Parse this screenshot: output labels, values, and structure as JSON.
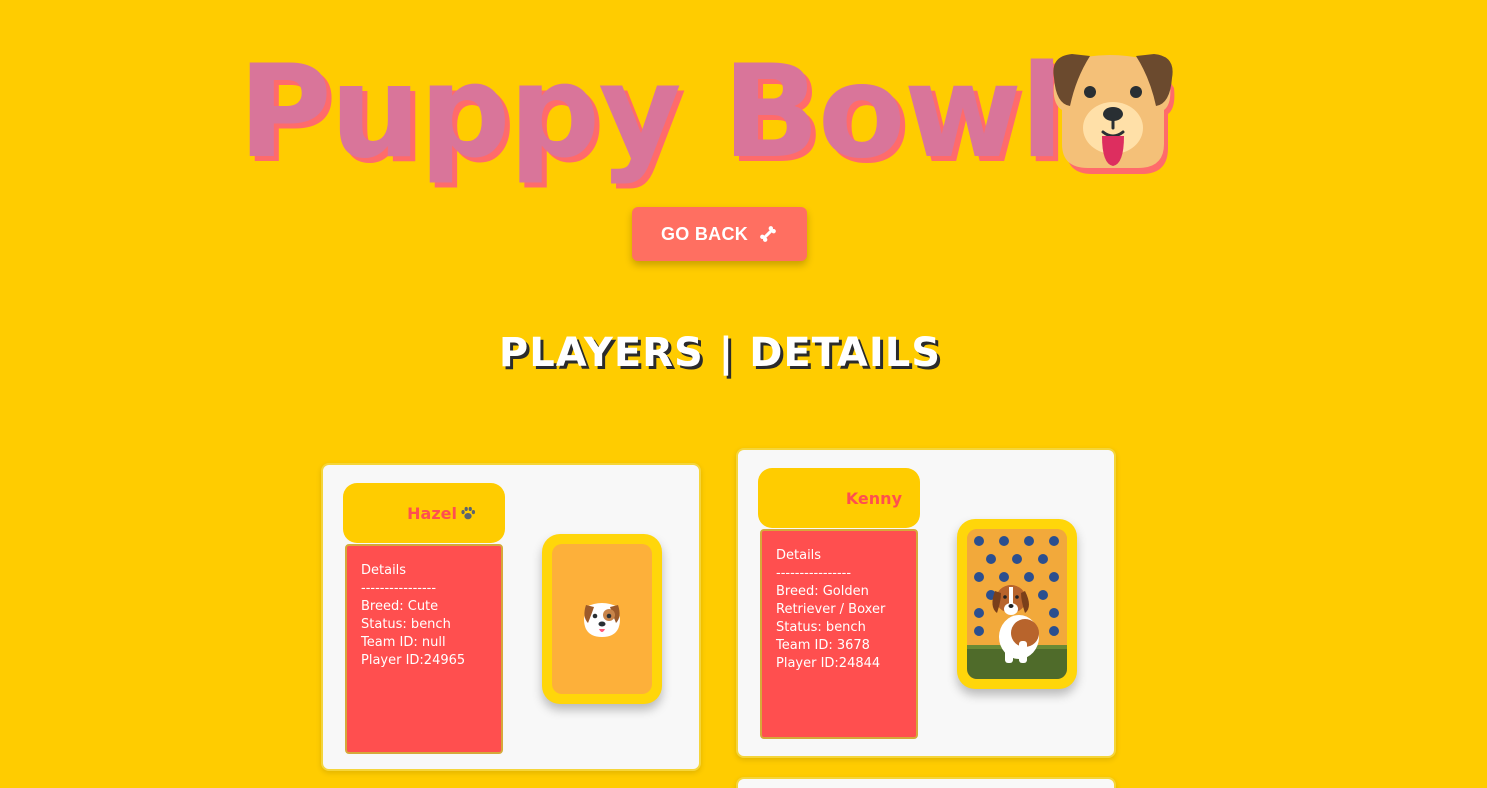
{
  "header": {
    "title": "Puppy Bowls",
    "title_icon": "dog-face-icon"
  },
  "nav": {
    "go_back_label": "GO BACK",
    "go_back_icon": "bone-icon"
  },
  "section": {
    "heading": "PLAYERS | DETAILS"
  },
  "players": [
    {
      "name": "Hazel",
      "name_icon": "paw-icon",
      "details_title": "Details",
      "divider": "----------------",
      "breed": "Breed: Cute",
      "status": "Status: bench",
      "team_id": "Team ID: null",
      "player_id": "Player ID:24965",
      "image": "puppy-placeholder-icon"
    },
    {
      "name": "Kenny",
      "details_title": "Details",
      "divider": "----------------",
      "breed": "Breed: Golden Retriever / Boxer",
      "status": "Status: bench",
      "team_id": "Team ID: 3678",
      "player_id": "Player ID:24844",
      "image": "puppy-photo"
    }
  ],
  "colors": {
    "background": "#ffcc00",
    "title": "#d9759a",
    "title_shadow": "#ff6b6b",
    "button": "#ff6f61",
    "card": "#f8f8f8",
    "details_box": "#ff4f4f",
    "name_text": "#ff4f4f",
    "photo_frame": "#ffd60a"
  }
}
